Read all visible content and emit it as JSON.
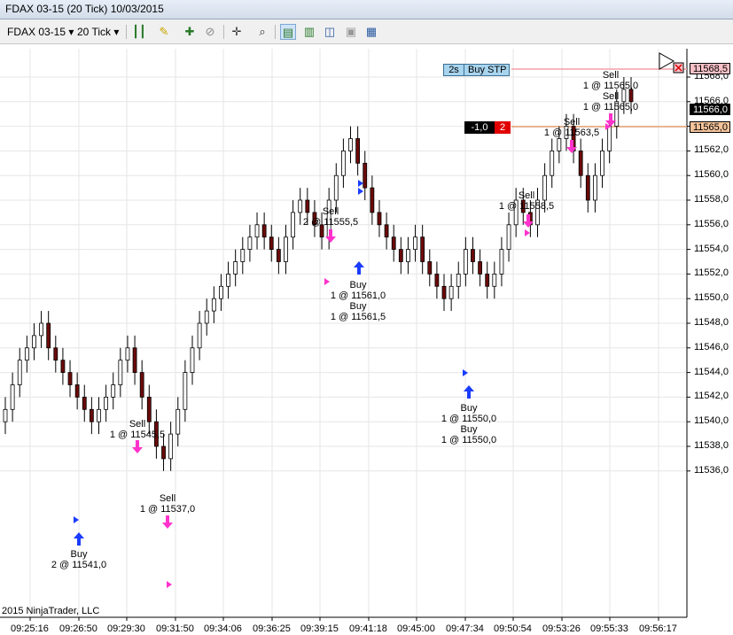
{
  "window": {
    "title": "FDAX 03-15 (20 Tick)  10/03/2015"
  },
  "toolbar": {
    "instrument": "FDAX 03-15",
    "interval": "20 Tick",
    "icons": [
      "bar-type-icon",
      "drawing-tool-icon",
      "zoom-in-icon",
      "zoom-out-icon",
      "crosshair-icon",
      "magnifier-icon",
      "chart-trader-icon",
      "data-series-icon",
      "indicators-icon",
      "strategies-icon",
      "properties-icon"
    ]
  },
  "y_axis": {
    "labels": [
      "11568,0",
      "11566,0",
      "11564,0",
      "11562,0",
      "11560,0",
      "11558,0",
      "11556,0",
      "11554,0",
      "11552,0",
      "11550,0",
      "11548,0",
      "11546,0",
      "11544,0",
      "11542,0",
      "11540,0",
      "11538,0",
      "11536,0"
    ],
    "current_price": "11566,0",
    "stop_price": "11568,5",
    "position_price": "11565,0"
  },
  "x_axis": {
    "labels": [
      "09:25:16",
      "09:26:50",
      "09:29:30",
      "09:31:50",
      "09:34:06",
      "09:36:25",
      "09:39:15",
      "09:41:18",
      "09:45:00",
      "09:47:34",
      "09:50:54",
      "09:53:26",
      "09:55:33",
      "09:56:17"
    ]
  },
  "order": {
    "qty": "2s",
    "type": "Buy STP"
  },
  "position": {
    "pnl": "-1,0",
    "qty": "2"
  },
  "annotations": [
    {
      "id": "sell-1",
      "lines": [
        "Sell",
        "1 @ 11545,5"
      ]
    },
    {
      "id": "buy-1",
      "lines": [
        "Buy",
        "2 @ 11541,0"
      ]
    },
    {
      "id": "sell-2",
      "lines": [
        "Sell",
        "1 @ 11537,0"
      ]
    },
    {
      "id": "sell-3",
      "lines": [
        "Sell",
        "2 @ 11555,5"
      ]
    },
    {
      "id": "buy-2",
      "lines": [
        "Buy",
        "1 @ 11561,0",
        "Buy",
        "1 @ 11561,5"
      ]
    },
    {
      "id": "buy-3",
      "lines": [
        "Buy",
        "1 @ 11550,0",
        "Buy",
        "1 @ 11550,0"
      ]
    },
    {
      "id": "sell-4",
      "lines": [
        "Sell",
        "1 @ 11558,5"
      ]
    },
    {
      "id": "sell-5",
      "lines": [
        "Sell",
        "1 @ 11563,5"
      ]
    },
    {
      "id": "sell-6",
      "lines": [
        "Sell",
        "1 @ 11565,0",
        "Sell",
        "1 @ 11565,0"
      ]
    }
  ],
  "copyright": "2015 NinjaTrader, LLC",
  "colors": {
    "up": "#2f4f2f",
    "down": "#6b0a0a",
    "sell_arrow": "#ff33cc",
    "buy_arrow": "#1a3cff",
    "stop_line": "#f4a0a8",
    "position_line": "#e0a070"
  }
}
